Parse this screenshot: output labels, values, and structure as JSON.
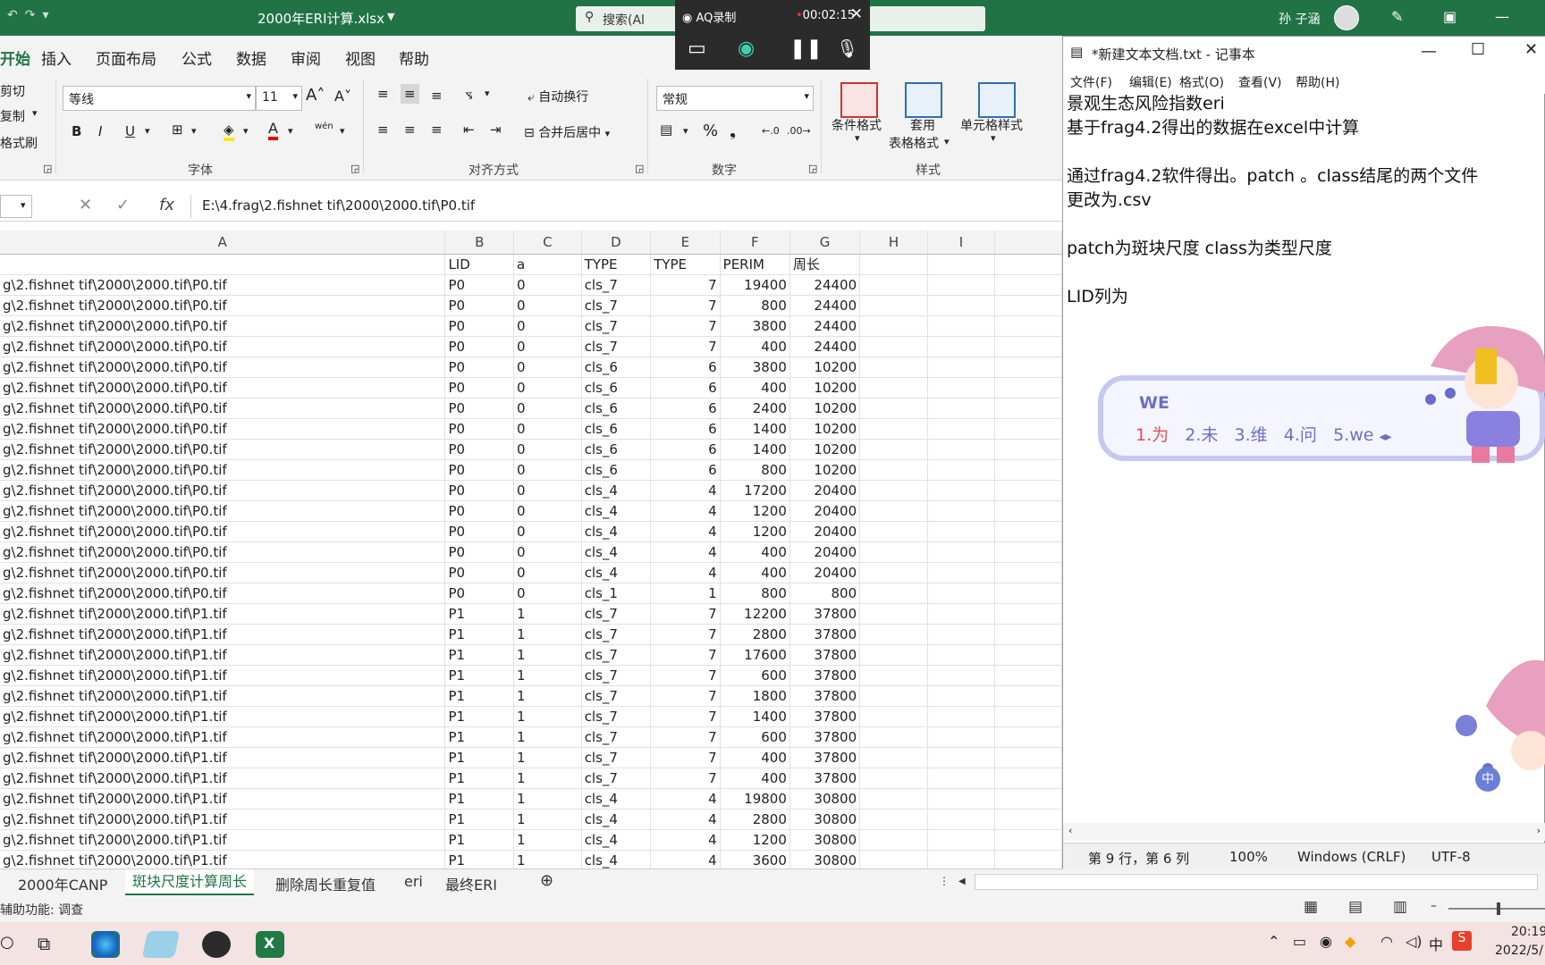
{
  "excel": {
    "title": "2000年ERI计算.xlsx",
    "search_placeholder": "搜索(Al",
    "user_name": "孙 子涵",
    "tabs": [
      "开始",
      "插入",
      "页面布局",
      "公式",
      "数据",
      "审阅",
      "视图",
      "帮助"
    ],
    "active_tab": "开始",
    "clipboard": {
      "cut": "剪切",
      "copy": "复制",
      "format_painter": "格式刷"
    },
    "font": {
      "name": "等线",
      "size": "11",
      "group_label": "字体",
      "bold": "B",
      "italic": "I",
      "underline": "U",
      "phonetic": "wén"
    },
    "alignment": {
      "wrap": "自动换行",
      "merge": "合并后居中",
      "group_label": "对齐方式"
    },
    "number": {
      "format": "常规",
      "group_label": "数字"
    },
    "styles": {
      "conditional": "条件格式",
      "table_format_1": "套用",
      "table_format_2": "表格格式",
      "cell_styles": "单元格样式",
      "group_label": "样式"
    },
    "formula_bar": {
      "fx": "fx",
      "value": "E:\\4.frag\\2.fishnet tif\\2000\\2000.tif\\P0.tif"
    },
    "columns": [
      "A",
      "B",
      "C",
      "D",
      "E",
      "F",
      "G",
      "H",
      "I"
    ],
    "header_row": [
      "",
      "LID",
      "a",
      "TYPE",
      "TYPE",
      "PERIM",
      "周长",
      "",
      ""
    ],
    "rows": [
      [
        "g\\2.fishnet tif\\2000\\2000.tif\\P0.tif",
        "P0",
        "0",
        "cls_7",
        "7",
        "19400",
        "24400"
      ],
      [
        "g\\2.fishnet tif\\2000\\2000.tif\\P0.tif",
        "P0",
        "0",
        "cls_7",
        "7",
        "800",
        "24400"
      ],
      [
        "g\\2.fishnet tif\\2000\\2000.tif\\P0.tif",
        "P0",
        "0",
        "cls_7",
        "7",
        "3800",
        "24400"
      ],
      [
        "g\\2.fishnet tif\\2000\\2000.tif\\P0.tif",
        "P0",
        "0",
        "cls_7",
        "7",
        "400",
        "24400"
      ],
      [
        "g\\2.fishnet tif\\2000\\2000.tif\\P0.tif",
        "P0",
        "0",
        "cls_6",
        "6",
        "3800",
        "10200"
      ],
      [
        "g\\2.fishnet tif\\2000\\2000.tif\\P0.tif",
        "P0",
        "0",
        "cls_6",
        "6",
        "400",
        "10200"
      ],
      [
        "g\\2.fishnet tif\\2000\\2000.tif\\P0.tif",
        "P0",
        "0",
        "cls_6",
        "6",
        "2400",
        "10200"
      ],
      [
        "g\\2.fishnet tif\\2000\\2000.tif\\P0.tif",
        "P0",
        "0",
        "cls_6",
        "6",
        "1400",
        "10200"
      ],
      [
        "g\\2.fishnet tif\\2000\\2000.tif\\P0.tif",
        "P0",
        "0",
        "cls_6",
        "6",
        "1400",
        "10200"
      ],
      [
        "g\\2.fishnet tif\\2000\\2000.tif\\P0.tif",
        "P0",
        "0",
        "cls_6",
        "6",
        "800",
        "10200"
      ],
      [
        "g\\2.fishnet tif\\2000\\2000.tif\\P0.tif",
        "P0",
        "0",
        "cls_4",
        "4",
        "17200",
        "20400"
      ],
      [
        "g\\2.fishnet tif\\2000\\2000.tif\\P0.tif",
        "P0",
        "0",
        "cls_4",
        "4",
        "1200",
        "20400"
      ],
      [
        "g\\2.fishnet tif\\2000\\2000.tif\\P0.tif",
        "P0",
        "0",
        "cls_4",
        "4",
        "1200",
        "20400"
      ],
      [
        "g\\2.fishnet tif\\2000\\2000.tif\\P0.tif",
        "P0",
        "0",
        "cls_4",
        "4",
        "400",
        "20400"
      ],
      [
        "g\\2.fishnet tif\\2000\\2000.tif\\P0.tif",
        "P0",
        "0",
        "cls_4",
        "4",
        "400",
        "20400"
      ],
      [
        "g\\2.fishnet tif\\2000\\2000.tif\\P0.tif",
        "P0",
        "0",
        "cls_1",
        "1",
        "800",
        "800"
      ],
      [
        "g\\2.fishnet tif\\2000\\2000.tif\\P1.tif",
        "P1",
        "1",
        "cls_7",
        "7",
        "12200",
        "37800"
      ],
      [
        "g\\2.fishnet tif\\2000\\2000.tif\\P1.tif",
        "P1",
        "1",
        "cls_7",
        "7",
        "2800",
        "37800"
      ],
      [
        "g\\2.fishnet tif\\2000\\2000.tif\\P1.tif",
        "P1",
        "1",
        "cls_7",
        "7",
        "17600",
        "37800"
      ],
      [
        "g\\2.fishnet tif\\2000\\2000.tif\\P1.tif",
        "P1",
        "1",
        "cls_7",
        "7",
        "600",
        "37800"
      ],
      [
        "g\\2.fishnet tif\\2000\\2000.tif\\P1.tif",
        "P1",
        "1",
        "cls_7",
        "7",
        "1800",
        "37800"
      ],
      [
        "g\\2.fishnet tif\\2000\\2000.tif\\P1.tif",
        "P1",
        "1",
        "cls_7",
        "7",
        "1400",
        "37800"
      ],
      [
        "g\\2.fishnet tif\\2000\\2000.tif\\P1.tif",
        "P1",
        "1",
        "cls_7",
        "7",
        "600",
        "37800"
      ],
      [
        "g\\2.fishnet tif\\2000\\2000.tif\\P1.tif",
        "P1",
        "1",
        "cls_7",
        "7",
        "400",
        "37800"
      ],
      [
        "g\\2.fishnet tif\\2000\\2000.tif\\P1.tif",
        "P1",
        "1",
        "cls_7",
        "7",
        "400",
        "37800"
      ],
      [
        "g\\2.fishnet tif\\2000\\2000.tif\\P1.tif",
        "P1",
        "1",
        "cls_4",
        "4",
        "19800",
        "30800"
      ],
      [
        "g\\2.fishnet tif\\2000\\2000.tif\\P1.tif",
        "P1",
        "1",
        "cls_4",
        "4",
        "2800",
        "30800"
      ],
      [
        "g\\2.fishnet tif\\2000\\2000.tif\\P1.tif",
        "P1",
        "1",
        "cls_4",
        "4",
        "1200",
        "30800"
      ],
      [
        "g\\2.fishnet tif\\2000\\2000.tif\\P1.tif",
        "P1",
        "1",
        "cls_4",
        "4",
        "3600",
        "30800"
      ]
    ],
    "sheet_tabs": [
      "2000年CANP",
      "斑块尺度计算周长",
      "删除周长重复值",
      "eri",
      "最终ERI"
    ],
    "active_sheet": "斑块尺度计算周长",
    "status_text": "辅助功能: 调查"
  },
  "recorder": {
    "title": "AQ录制",
    "time": "00:02:15"
  },
  "notepad": {
    "title": "*新建文本文档.txt - 记事本",
    "menu": [
      "文件(F)",
      "编辑(E)",
      "格式(O)",
      "查看(V)",
      "帮助(H)"
    ],
    "lines": [
      "景观生态风险指数eri",
      "基于frag4.2得出的数据在excel中计算",
      "",
      "通过frag4.2软件得出。patch 。class结尾的两个文件",
      "更改为.csv",
      "",
      "patch为斑块尺度   class为类型尺度",
      "",
      "LID列为"
    ],
    "status": {
      "position": "第 9 行，第 6 列",
      "zoom": "100%",
      "line_ending": "Windows (CRLF)",
      "encoding": "UTF-8"
    }
  },
  "ime": {
    "input": "WE",
    "candidates": [
      "1.为",
      "2.未",
      "3.维",
      "4.问",
      "5.we"
    ],
    "mode": "中"
  },
  "taskbar": {
    "time": "20:19",
    "date": "2022/5/"
  }
}
